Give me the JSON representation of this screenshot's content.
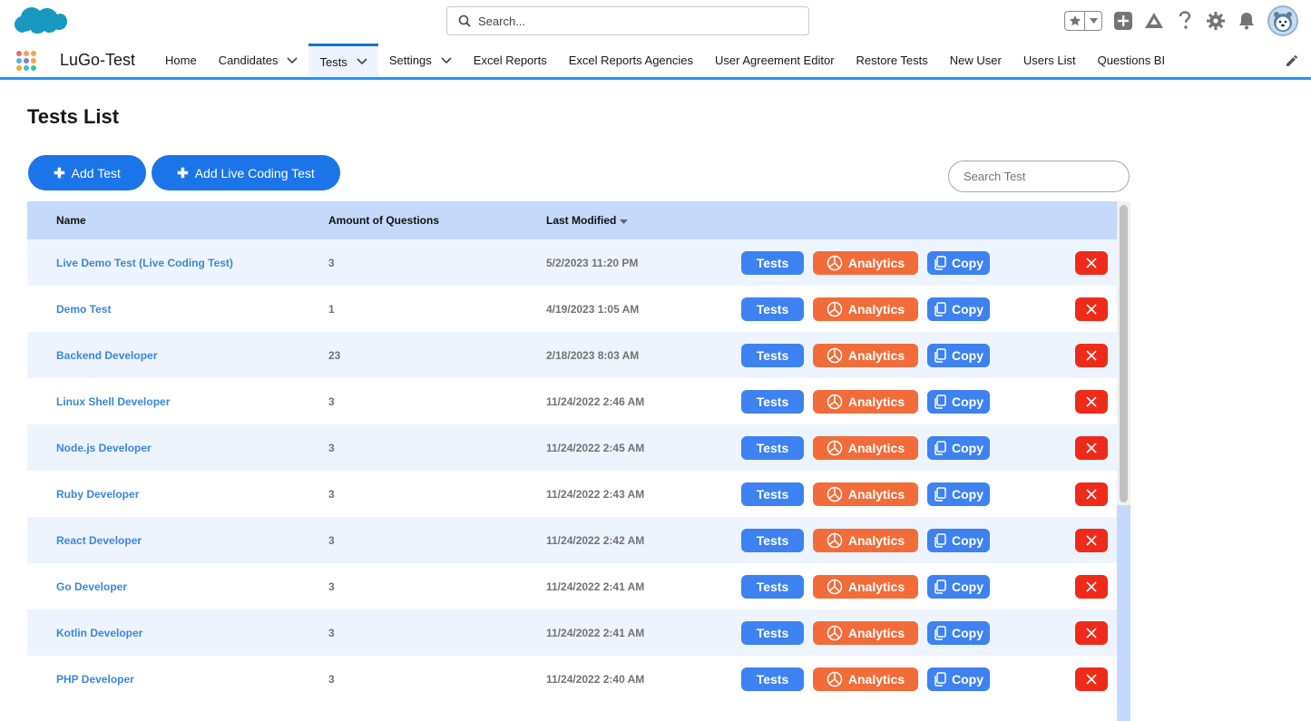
{
  "header": {
    "search_placeholder": "Search..."
  },
  "nav": {
    "app_name": "LuGo-Test",
    "items": [
      {
        "label": "Home",
        "dropdown": false,
        "active": false
      },
      {
        "label": "Candidates",
        "dropdown": true,
        "active": false
      },
      {
        "label": "Tests",
        "dropdown": true,
        "active": true
      },
      {
        "label": "Settings",
        "dropdown": true,
        "active": false
      },
      {
        "label": "Excel Reports",
        "dropdown": false,
        "active": false
      },
      {
        "label": "Excel Reports Agencies",
        "dropdown": false,
        "active": false
      },
      {
        "label": "User Agreement Editor",
        "dropdown": false,
        "active": false
      },
      {
        "label": "Restore Tests",
        "dropdown": false,
        "active": false
      },
      {
        "label": "New User",
        "dropdown": false,
        "active": false
      },
      {
        "label": "Users List",
        "dropdown": false,
        "active": false
      },
      {
        "label": "Questions BI",
        "dropdown": false,
        "active": false
      }
    ]
  },
  "main": {
    "title": "Tests List",
    "add_test_label": "Add Test",
    "add_live_label": "Add Live Coding Test",
    "search_placeholder": "Search Test"
  },
  "table": {
    "columns": {
      "name": "Name",
      "amount": "Amount of Questions",
      "modified": "Last Modified"
    },
    "actions": {
      "tests": "Tests",
      "analytics": "Analytics",
      "copy": "Copy"
    },
    "rows": [
      {
        "name": "Live Demo Test (Live Coding Test)",
        "amount": "3",
        "modified": "5/2/2023 11:20 PM"
      },
      {
        "name": "Demo Test",
        "amount": "1",
        "modified": "4/19/2023 1:05 AM"
      },
      {
        "name": "Backend Developer",
        "amount": "23",
        "modified": "2/18/2023 8:03 AM"
      },
      {
        "name": "Linux Shell Developer",
        "amount": "3",
        "modified": "11/24/2022 2:46 AM"
      },
      {
        "name": "Node.js Developer",
        "amount": "3",
        "modified": "11/24/2022 2:45 AM"
      },
      {
        "name": "Ruby Developer",
        "amount": "3",
        "modified": "11/24/2022 2:43 AM"
      },
      {
        "name": "React Developer",
        "amount": "3",
        "modified": "11/24/2022 2:42 AM"
      },
      {
        "name": "Go Developer",
        "amount": "3",
        "modified": "11/24/2022 2:41 AM"
      },
      {
        "name": "Kotlin Developer",
        "amount": "3",
        "modified": "11/24/2022 2:41 AM"
      },
      {
        "name": "PHP Developer",
        "amount": "3",
        "modified": "11/24/2022 2:40 AM"
      }
    ]
  },
  "colors": {
    "brand_blue": "#1b74e8",
    "tests_button": "#3d82f0",
    "analytics_button": "#f26c3a",
    "delete_button": "#ee2b1b",
    "header_row": "#c5d9fb"
  }
}
